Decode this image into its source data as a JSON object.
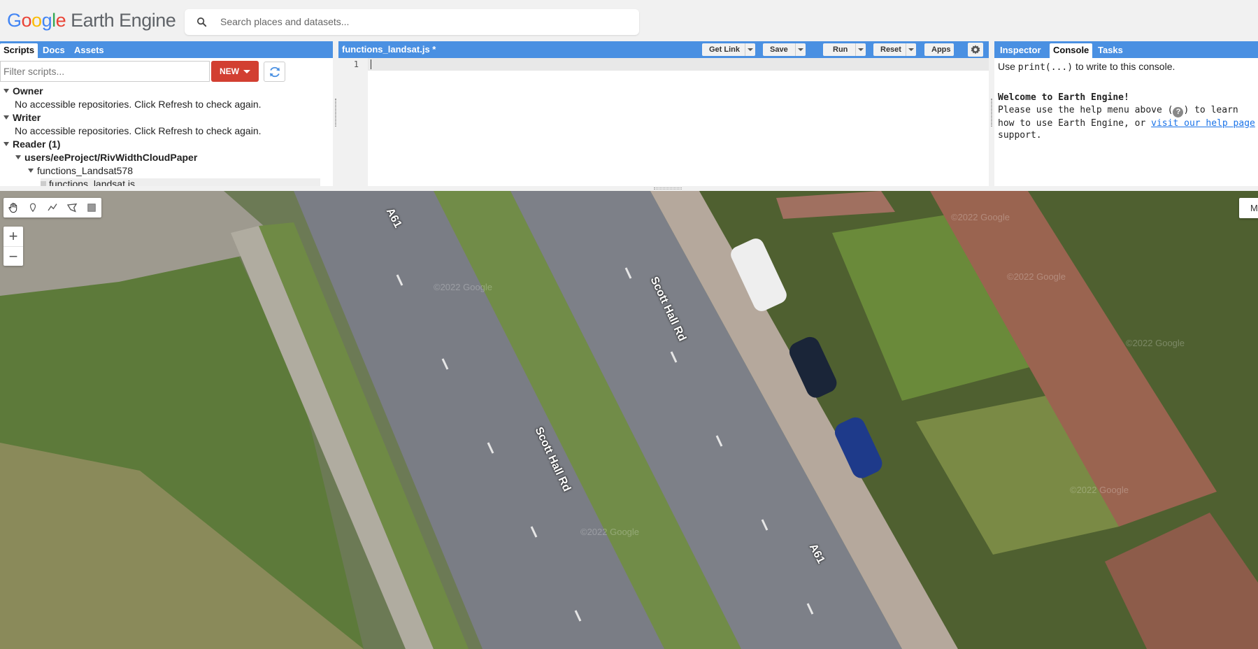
{
  "header": {
    "logo_letters": [
      "G",
      "o",
      "o",
      "g",
      "l",
      "e"
    ],
    "logo_product": "Earth Engine",
    "search_placeholder": "Search places and datasets..."
  },
  "left_panel": {
    "tabs": [
      "Scripts",
      "Docs",
      "Assets"
    ],
    "active_tab": "Scripts",
    "filter_placeholder": "Filter scripts...",
    "new_button": "NEW",
    "tree": {
      "owner_label": "Owner",
      "owner_msg": "No accessible repositories. Click Refresh to check again.",
      "writer_label": "Writer",
      "writer_msg": "No accessible repositories. Click Refresh to check again.",
      "reader_label": "Reader (1)",
      "repo": "users/eeProject/RivWidthCloudPaper",
      "folder": "functions_Landsat578",
      "file": "functions_landsat.js"
    }
  },
  "code_panel": {
    "file_title": "functions_landsat.js *",
    "buttons": {
      "get_link": "Get Link",
      "save": "Save",
      "run": "Run",
      "reset": "Reset",
      "apps": "Apps"
    },
    "line_number": "1"
  },
  "right_panel": {
    "tabs": [
      "Inspector",
      "Console",
      "Tasks"
    ],
    "active_tab": "Console",
    "hint_pre": "Use ",
    "hint_code": "print(...)",
    "hint_post": " to write to this console.",
    "welcome_title": "Welcome to Earth Engine!",
    "welcome_line1_pre": "Please use the help menu above (",
    "welcome_line1_post": ") to learn",
    "welcome_line2_pre": "how to use Earth Engine, or ",
    "welcome_link": "visit our help page",
    "welcome_line3": "support."
  },
  "map": {
    "layers_button": "M",
    "zoom_in": "+",
    "zoom_out": "−",
    "road_labels": [
      "A61",
      "Scott Hall Rd",
      "Scott Hall Rd",
      "A61"
    ],
    "watermark": "©2022 Google"
  },
  "colors": {
    "brand_blue": "#4a90e2",
    "new_button_red": "#d23f31",
    "link_blue": "#1a73e8"
  }
}
